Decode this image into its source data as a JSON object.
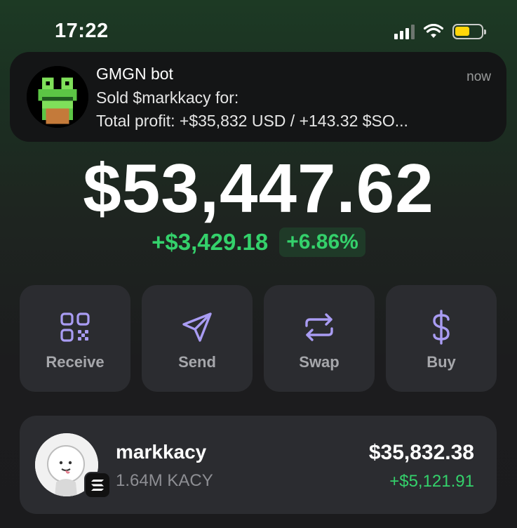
{
  "status_bar": {
    "time": "17:22",
    "battery_color": "#ffd60a"
  },
  "notification": {
    "app": "GMGN bot",
    "line1": "Sold $markkacy for:",
    "line2": "Total profit: +$35,832 USD / +143.32 $SO...",
    "time": "now",
    "avatar_icon": "pixel-frog-icon"
  },
  "portfolio": {
    "balance": "$53,447.62",
    "change_amount": "+$3,429.18",
    "change_percent": "+6.86%",
    "positive_color": "#34d16b"
  },
  "actions": [
    {
      "label": "Receive",
      "icon": "qr-code-icon"
    },
    {
      "label": "Send",
      "icon": "send-icon"
    },
    {
      "label": "Swap",
      "icon": "swap-icon"
    },
    {
      "label": "Buy",
      "icon": "dollar-icon"
    }
  ],
  "tokens": [
    {
      "name": "markkacy",
      "amount": "1.64M KACY",
      "value": "$35,832.38",
      "change": "+$5,121.91",
      "chain_icon": "solana-icon"
    }
  ],
  "accent_color": "#a99cf3"
}
